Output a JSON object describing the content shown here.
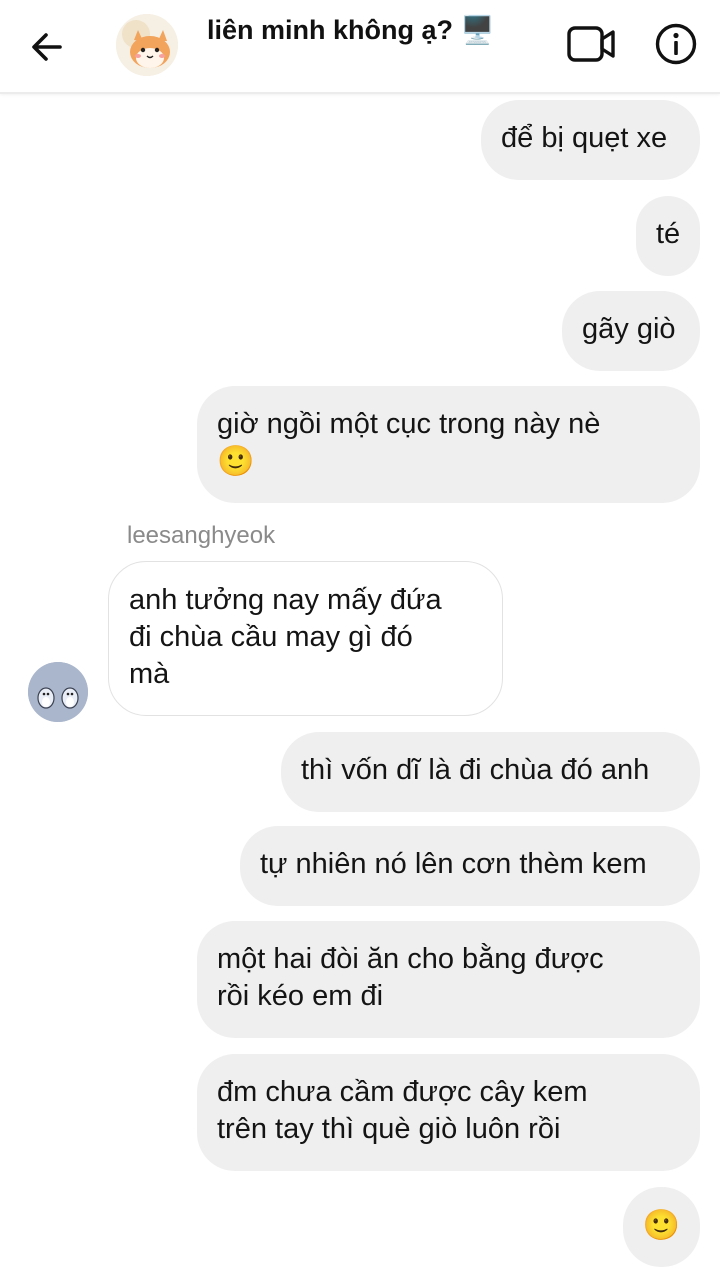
{
  "header": {
    "title": "liên minh không ạ? 🖥️"
  },
  "messages": {
    "m1": "để bị quẹt xe",
    "m2": "té",
    "m3": "gãy giò",
    "m4_line1": "giờ ngồi một cục trong này nè",
    "m4_line2": "🙂",
    "sender_name": "leesanghyeok",
    "m5_line1": "anh tưởng nay mấy đứa",
    "m5_line2": "đi chùa cầu may gì đó",
    "m5_line3": "mà",
    "m6": "thì vốn dĩ là đi chùa đó anh",
    "m7": "tự nhiên nó lên cơn thèm kem",
    "m8_line1": "một hai đòi ăn cho bằng được",
    "m8_line2": "rồi kéo em đi",
    "m9_line1": "đm chưa cầm được cây kem",
    "m9_line2": "trên tay thì què giò luôn rồi",
    "m10": "🙂"
  },
  "colors": {
    "outgoing_bubble": "#efefef",
    "incoming_bubble": "#ffffff",
    "sender_name": "#8a8a8a"
  },
  "icons": {
    "back": "arrow-left-icon",
    "video": "video-camera-icon",
    "info": "info-icon"
  }
}
